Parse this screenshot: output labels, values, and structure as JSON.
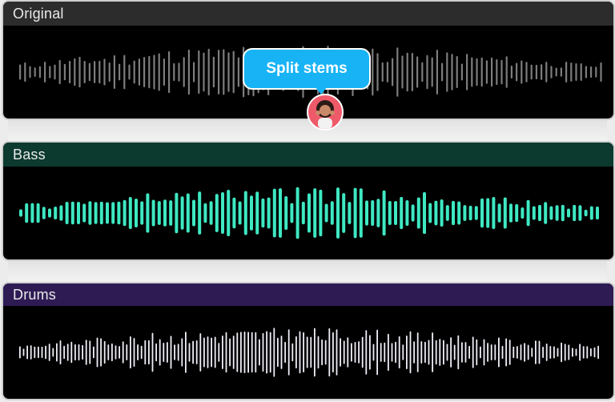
{
  "tracks": [
    {
      "name": "Original",
      "wave_color": "#7d7d7d",
      "header_color": "#2c2c2c"
    },
    {
      "name": "Bass",
      "wave_color": "#3ee8c2",
      "header_color": "#0c3a2e"
    },
    {
      "name": "Drums",
      "wave_color": "#f1eef8",
      "header_color": "#2e1b54"
    }
  ],
  "tooltip": {
    "label": "Split stems",
    "color": "#17b3f5"
  },
  "avatar": {
    "icon": "user-avatar-icon"
  }
}
